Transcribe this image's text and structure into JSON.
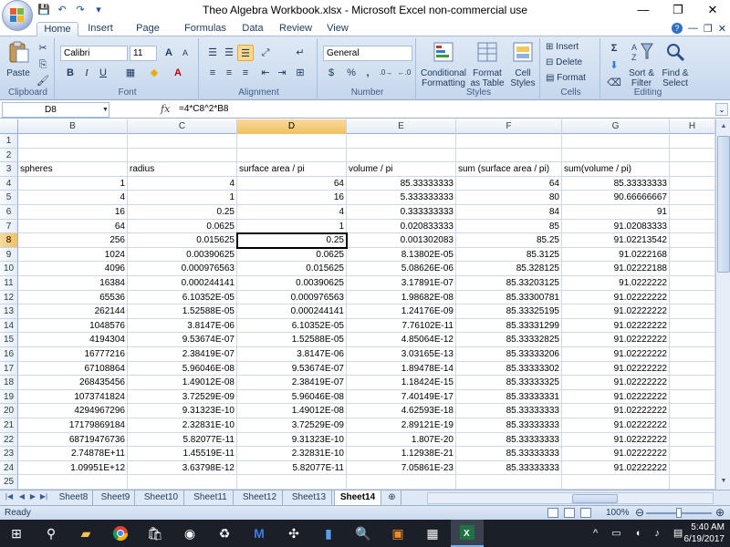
{
  "window": {
    "title": "Theo Algebra Workbook.xlsx - Microsoft Excel non-commercial use",
    "controls": {
      "minimize": "—",
      "restore": "❐",
      "close": "✕"
    }
  },
  "qat": {
    "save": "💾",
    "undo": "↶",
    "redo": "↷",
    "customize": "▾"
  },
  "ribbon_tabs": [
    "Home",
    "Insert",
    "Page Layout",
    "Formulas",
    "Data",
    "Review",
    "View"
  ],
  "ribbon_right": {
    "help": "?",
    "minimize": "—",
    "restore": "❐",
    "close": "✕"
  },
  "ribbon": {
    "clipboard": {
      "label": "Clipboard",
      "paste": "Paste"
    },
    "font": {
      "label": "Font",
      "name": "Calibri",
      "size": "11",
      "bold": "B",
      "italic": "I",
      "underline": "U",
      "grow": "A",
      "shrink": "A"
    },
    "alignment": {
      "label": "Alignment"
    },
    "number": {
      "label": "Number",
      "format": "General",
      "currency": "$",
      "percent": "%",
      "comma": ","
    },
    "styles": {
      "label": "Styles",
      "conditional": "Conditional Formatting",
      "format_table": "Format as Table",
      "cell_styles": "Cell Styles"
    },
    "cells": {
      "label": "Cells",
      "insert": "Insert",
      "delete": "Delete",
      "format": "Format"
    },
    "editing": {
      "label": "Editing",
      "sigma": "Σ",
      "sort": "Sort & Filter",
      "find": "Find & Select"
    }
  },
  "formula_bar": {
    "name_box": "D8",
    "fx": "fx",
    "formula": "=4*C8^2*B8"
  },
  "columns": [
    "B",
    "C",
    "D",
    "E",
    "F",
    "G",
    "H"
  ],
  "active_column": "D",
  "active_row": "8",
  "rows": [
    {
      "n": "1",
      "cells": [
        "",
        "",
        "",
        "",
        "",
        ""
      ]
    },
    {
      "n": "2",
      "cells": [
        "",
        "",
        "",
        "",
        "",
        ""
      ]
    },
    {
      "n": "3",
      "cells": [
        "spheres",
        "radius",
        "surface area / pi",
        "volume / pi",
        "sum (surface area / pi)",
        "sum(volume / pi)"
      ]
    },
    {
      "n": "4",
      "cells": [
        "1",
        "4",
        "64",
        "85.33333333",
        "64",
        "85.33333333"
      ]
    },
    {
      "n": "5",
      "cells": [
        "4",
        "1",
        "16",
        "5.333333333",
        "80",
        "90.66666667"
      ]
    },
    {
      "n": "6",
      "cells": [
        "16",
        "0.25",
        "4",
        "0.333333333",
        "84",
        "91"
      ]
    },
    {
      "n": "7",
      "cells": [
        "64",
        "0.0625",
        "1",
        "0.020833333",
        "85",
        "91.02083333"
      ]
    },
    {
      "n": "8",
      "cells": [
        "256",
        "0.015625",
        "0.25",
        "0.001302083",
        "85.25",
        "91.02213542"
      ]
    },
    {
      "n": "9",
      "cells": [
        "1024",
        "0.00390625",
        "0.0625",
        "8.13802E-05",
        "85.3125",
        "91.0222168"
      ]
    },
    {
      "n": "10",
      "cells": [
        "4096",
        "0.000976563",
        "0.015625",
        "5.08626E-06",
        "85.328125",
        "91.02222188"
      ]
    },
    {
      "n": "11",
      "cells": [
        "16384",
        "0.000244141",
        "0.00390625",
        "3.17891E-07",
        "85.33203125",
        "91.0222222"
      ]
    },
    {
      "n": "12",
      "cells": [
        "65536",
        "6.10352E-05",
        "0.000976563",
        "1.98682E-08",
        "85.33300781",
        "91.02222222"
      ]
    },
    {
      "n": "13",
      "cells": [
        "262144",
        "1.52588E-05",
        "0.000244141",
        "1.24176E-09",
        "85.33325195",
        "91.02222222"
      ]
    },
    {
      "n": "14",
      "cells": [
        "1048576",
        "3.8147E-06",
        "6.10352E-05",
        "7.76102E-11",
        "85.33331299",
        "91.02222222"
      ]
    },
    {
      "n": "15",
      "cells": [
        "4194304",
        "9.53674E-07",
        "1.52588E-05",
        "4.85064E-12",
        "85.33332825",
        "91.02222222"
      ]
    },
    {
      "n": "16",
      "cells": [
        "16777216",
        "2.38419E-07",
        "3.8147E-06",
        "3.03165E-13",
        "85.33333206",
        "91.02222222"
      ]
    },
    {
      "n": "17",
      "cells": [
        "67108864",
        "5.96046E-08",
        "9.53674E-07",
        "1.89478E-14",
        "85.33333302",
        "91.02222222"
      ]
    },
    {
      "n": "18",
      "cells": [
        "268435456",
        "1.49012E-08",
        "2.38419E-07",
        "1.18424E-15",
        "85.33333325",
        "91.02222222"
      ]
    },
    {
      "n": "19",
      "cells": [
        "1073741824",
        "3.72529E-09",
        "5.96046E-08",
        "7.40149E-17",
        "85.33333331",
        "91.02222222"
      ]
    },
    {
      "n": "20",
      "cells": [
        "4294967296",
        "9.31323E-10",
        "1.49012E-08",
        "4.62593E-18",
        "85.33333333",
        "91.02222222"
      ]
    },
    {
      "n": "21",
      "cells": [
        "17179869184",
        "2.32831E-10",
        "3.72529E-09",
        "2.89121E-19",
        "85.33333333",
        "91.02222222"
      ]
    },
    {
      "n": "22",
      "cells": [
        "68719476736",
        "5.82077E-11",
        "9.31323E-10",
        "1.807E-20",
        "85.33333333",
        "91.02222222"
      ]
    },
    {
      "n": "23",
      "cells": [
        "2.74878E+11",
        "1.45519E-11",
        "2.32831E-10",
        "1.12938E-21",
        "85.33333333",
        "91.02222222"
      ]
    },
    {
      "n": "24",
      "cells": [
        "1.09951E+12",
        "3.63798E-12",
        "5.82077E-11",
        "7.05861E-23",
        "85.33333333",
        "91.02222222"
      ]
    },
    {
      "n": "25",
      "cells": [
        "",
        "",
        "",
        "",
        "",
        ""
      ]
    }
  ],
  "sheets": [
    "Sheet8",
    "Sheet9",
    "Sheet10",
    "Sheet11",
    "Sheet12",
    "Sheet13",
    "Sheet14"
  ],
  "active_sheet": "Sheet14",
  "status": {
    "ready": "Ready",
    "zoom": "100%"
  },
  "taskbar": {
    "time": "5:40 AM",
    "date": "6/19/2017"
  },
  "colors": {
    "selection_header": "#f1c15f",
    "ribbon_bg": "#dfe9f5",
    "grid_line": "#d0d7e5",
    "taskbar": "#1b2028",
    "excel_green": "#1f7244"
  }
}
